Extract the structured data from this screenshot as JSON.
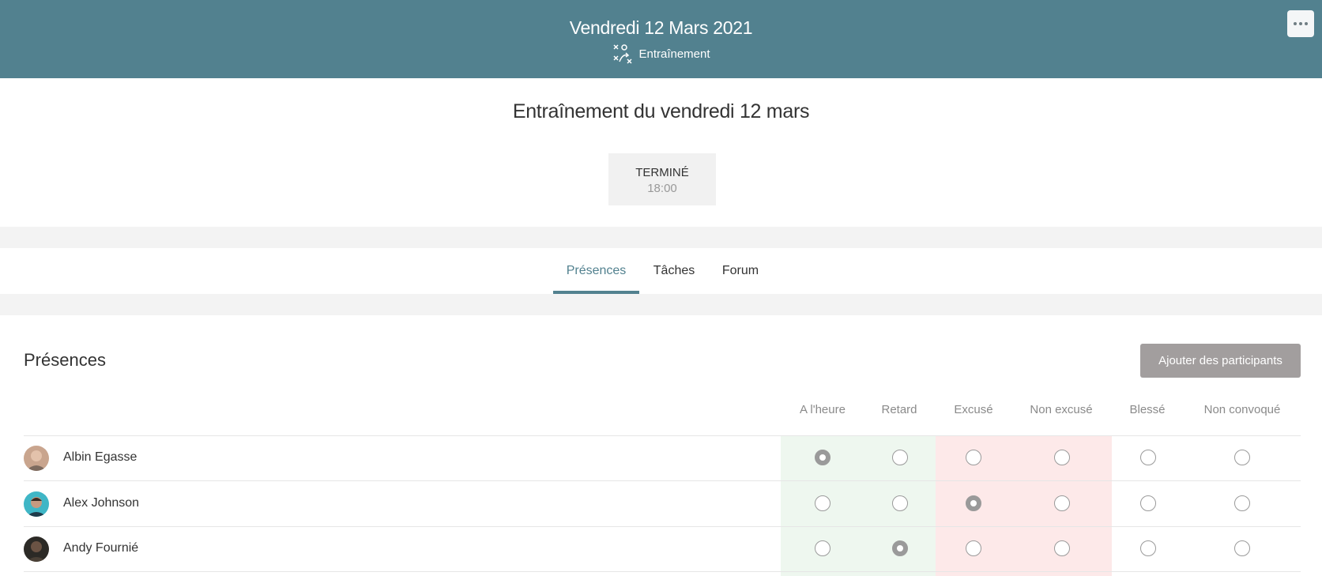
{
  "header": {
    "title": "Vendredi 12 Mars 2021",
    "event_type": "Entraînement",
    "event_type_icon": "tactics-icon",
    "more_icon": "more-horizontal-icon",
    "color": "#52818f"
  },
  "event": {
    "title": "Entraînement du vendredi 12 mars",
    "status": "TERMINÉ",
    "time": "18:00"
  },
  "tabs": [
    {
      "label": "Présences",
      "active": true
    },
    {
      "label": "Tâches",
      "active": false
    },
    {
      "label": "Forum",
      "active": false
    }
  ],
  "attendance": {
    "title": "Présences",
    "add_button": "Ajouter des participants",
    "columns": [
      "A l'heure",
      "Retard",
      "Excusé",
      "Non excusé",
      "Blessé",
      "Non convoqué"
    ],
    "players": [
      {
        "name": "Albin Egasse",
        "selected": 0
      },
      {
        "name": "Alex Johnson",
        "selected": 2
      },
      {
        "name": "Andy Fournié",
        "selected": 1
      }
    ]
  },
  "colors": {
    "accent": "#52818f",
    "present_bg": "#eef7ef",
    "absent_bg": "#fde9e9",
    "button_bg": "#a29e9e"
  }
}
